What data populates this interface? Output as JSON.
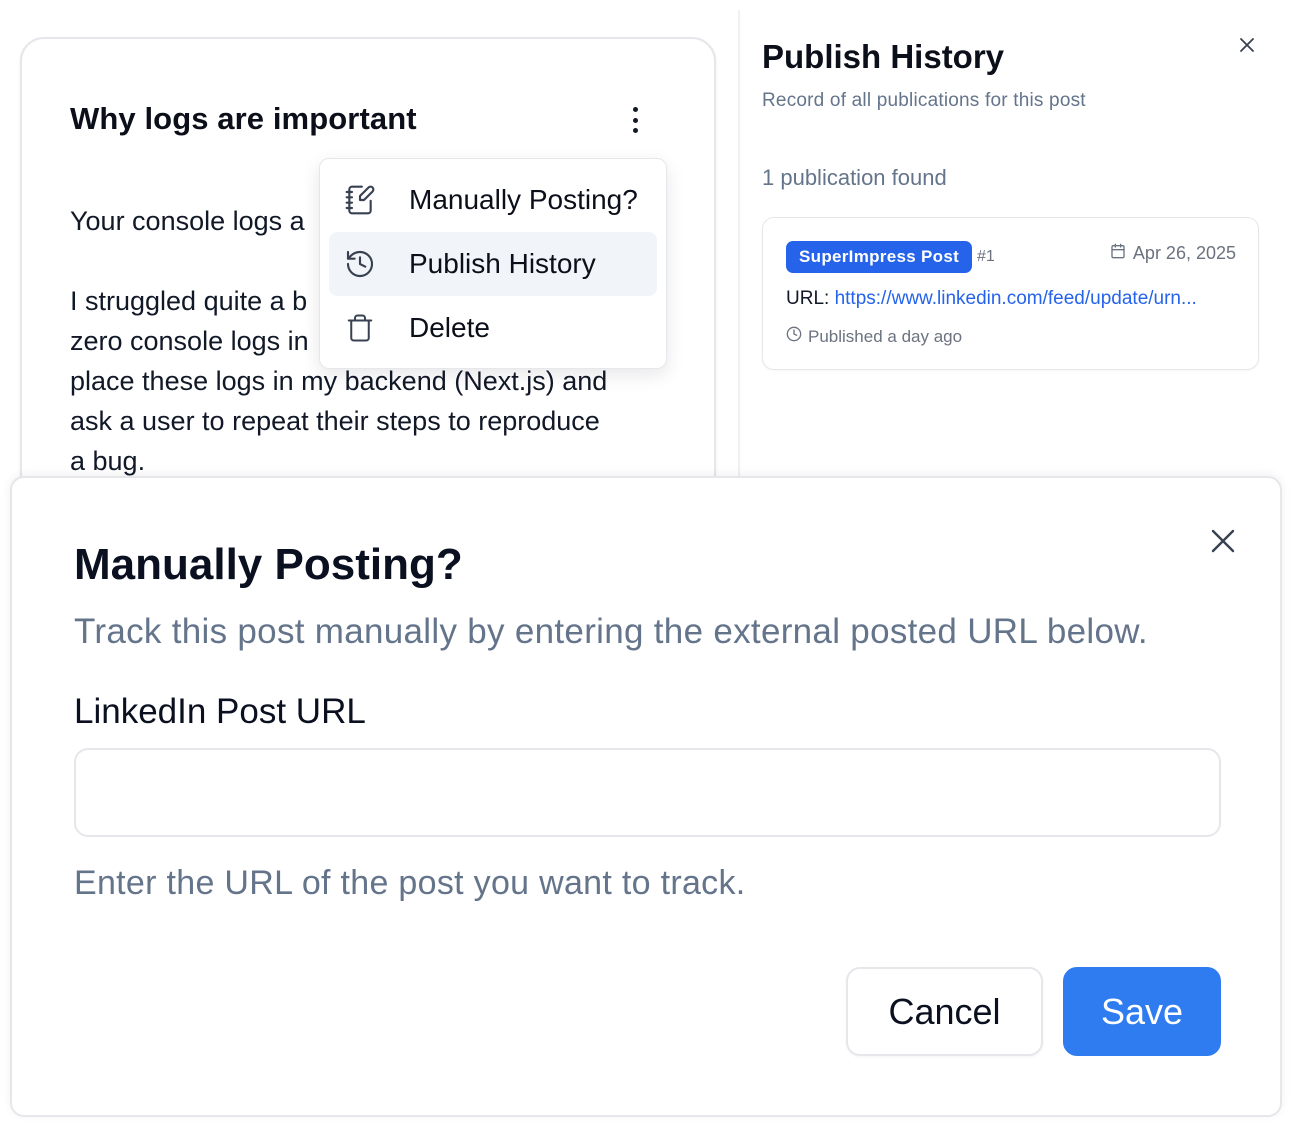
{
  "post": {
    "title": "Why logs are important",
    "paragraph1": "Your console logs a",
    "paragraph2": "I struggled quite a b\nzero console logs in\nplace these logs in my backend (Next.js) and\nask a user to repeat their steps to reproduce\na bug."
  },
  "menu": {
    "items": [
      {
        "label": "Manually Posting?",
        "icon": "notebook-pen-icon"
      },
      {
        "label": "Publish History",
        "icon": "history-icon",
        "active": true
      },
      {
        "label": "Delete",
        "icon": "trash-icon"
      }
    ]
  },
  "history_panel": {
    "title": "Publish History",
    "subtitle": "Record of all publications for this post",
    "count_text": "1 publication found",
    "publication": {
      "badge": "SuperImpress Post",
      "number": "#1",
      "date": "Apr 26, 2025",
      "url_label": "URL:",
      "url": "https://www.linkedin.com/feed/update/urn...",
      "published": "Published a day ago"
    }
  },
  "modal": {
    "title": "Manually Posting?",
    "description": "Track this post manually by entering the external posted URL below.",
    "field_label": "LinkedIn Post URL",
    "field_value": "",
    "field_help": "Enter the URL of the post you want to track.",
    "cancel_label": "Cancel",
    "save_label": "Save"
  },
  "colors": {
    "accent": "#2f7cf0",
    "badge": "#2563eb",
    "muted_text": "#64748b",
    "border": "#e5e7eb"
  }
}
